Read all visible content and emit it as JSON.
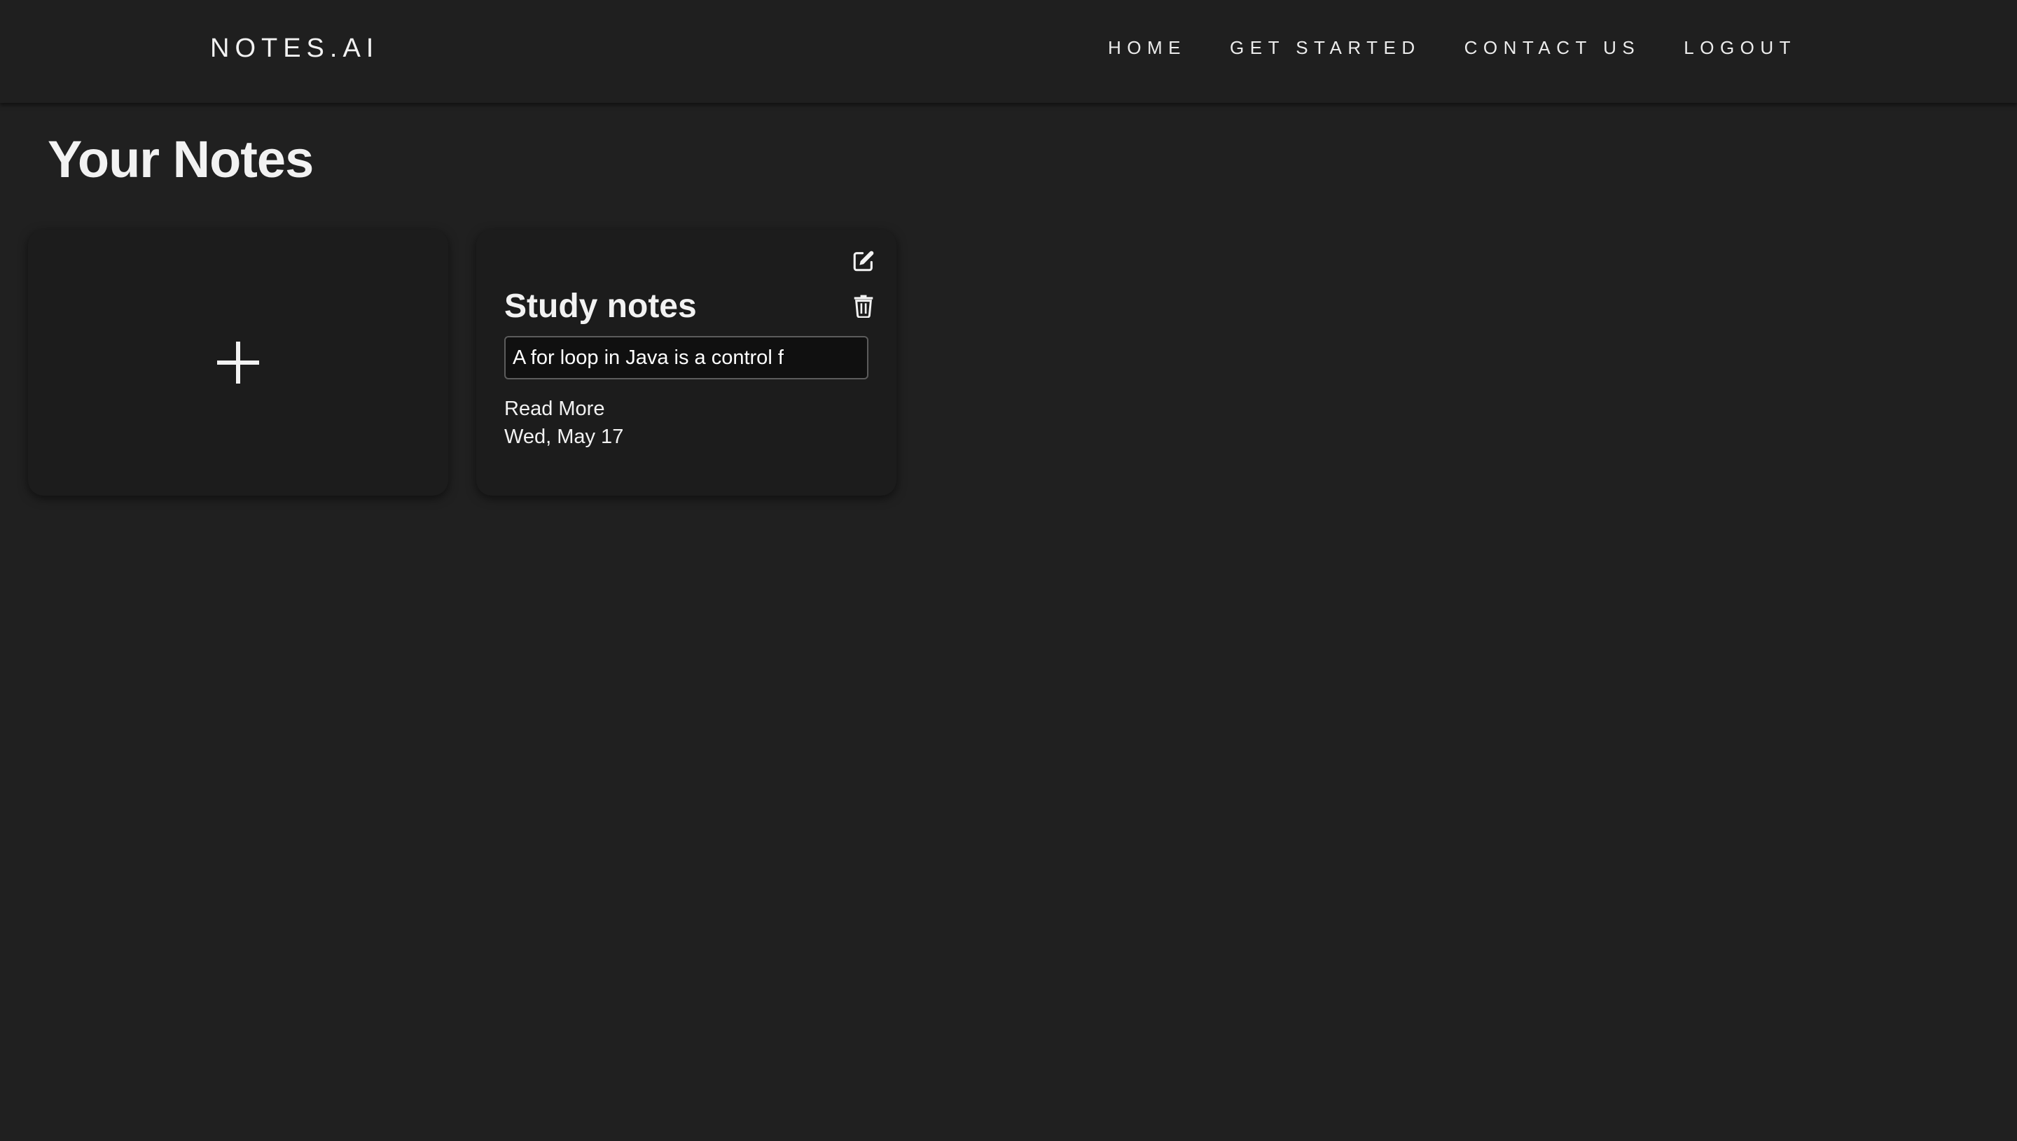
{
  "navbar": {
    "brand": "NOTES.AI",
    "links": [
      {
        "label": "HOME"
      },
      {
        "label": "GET STARTED"
      },
      {
        "label": "CONTACT US"
      },
      {
        "label": "LOGOUT"
      }
    ]
  },
  "page": {
    "title": "Your Notes"
  },
  "add_card": {
    "icon": "plus-icon"
  },
  "notes": [
    {
      "title": "Study notes",
      "preview": "A for loop in Java is a control f",
      "read_more": "Read More",
      "date": "Wed, May 17",
      "edit_icon": "edit-icon",
      "delete_icon": "trash-icon"
    }
  ],
  "colors": {
    "background": "#202020",
    "navbar": "#1f1f1f",
    "card": "#1c1c1c",
    "text": "#f2f2f2"
  }
}
